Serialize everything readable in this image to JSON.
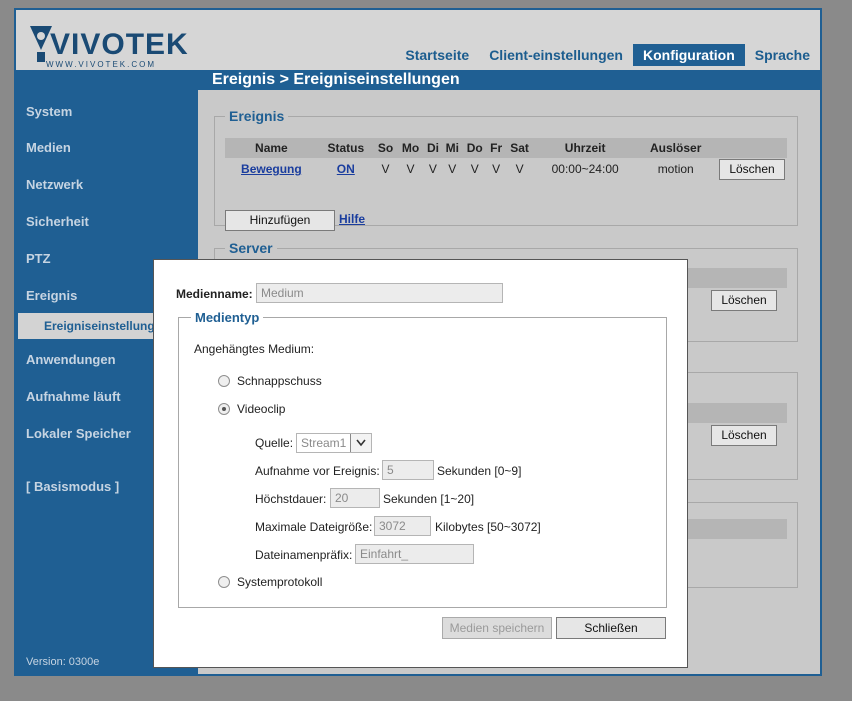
{
  "brand": {
    "name": "VIVOTEK",
    "url": "WWW.VIVOTEK.COM"
  },
  "topnav": [
    "Startseite",
    "Client-einstellungen",
    "Konfiguration",
    "Sprache"
  ],
  "breadcrumb": "Ereignis  > Ereigniseinstellungen",
  "sidebar": {
    "items": [
      "System",
      "Medien",
      "Netzwerk",
      "Sicherheit",
      "PTZ",
      "Ereignis"
    ],
    "sub_item": "Ereigniseinstellungen",
    "items_after": [
      "Anwendungen",
      "Aufnahme läuft",
      "Lokaler Speicher"
    ],
    "basic_mode": "[ Basismodus ]",
    "version": "Version: 0300e"
  },
  "event_section": {
    "legend": "Ereignis",
    "columns": [
      "Name",
      "Status",
      "So",
      "Mo",
      "Di",
      "Mi",
      "Do",
      "Fr",
      "Sat",
      "Uhrzeit",
      "Auslöser"
    ],
    "row": {
      "name": "Bewegung",
      "status": "ON",
      "days": [
        "V",
        "V",
        "V",
        "V",
        "V",
        "V",
        "V"
      ],
      "time": "00:00~24:00",
      "trigger": "motion",
      "delete": "Löschen"
    },
    "add_button": "Hinzufügen",
    "help_link": "Hilfe"
  },
  "server_section": {
    "legend": "Server",
    "delete": "Löschen"
  },
  "media_section": {
    "delete": "Löschen"
  },
  "modal": {
    "medianame_label": "Medienname:",
    "medianame_placeholder": "Medium",
    "mediatyp_legend": "Medientyp",
    "attached_label": "Angehängtes Medium:",
    "options": {
      "snapshot": "Schnappschuss",
      "videoclip": "Videoclip",
      "systemlog": "Systemprotokoll"
    },
    "selected_option": "Videoclip",
    "source_label": "Quelle:",
    "source_value": "Stream1",
    "pre_event_label": "Aufnahme vor Ereignis:",
    "pre_event_value": "5",
    "pre_event_unit": "Sekunden [0~9]",
    "max_duration_label": "Höchstdauer:",
    "max_duration_value": "20",
    "max_duration_unit": "Sekunden [1~20]",
    "max_size_label": "Maximale Dateigröße:",
    "max_size_value": "3072",
    "max_size_unit": "Kilobytes [50~3072]",
    "prefix_label": "Dateinamenpräfix:",
    "prefix_value": "Einfahrt_",
    "save_button": "Medien speichern",
    "close_button": "Schließen"
  },
  "colors": {
    "primary": "#1f5f93",
    "link": "#1a3d9e",
    "overlay": "#8a8a8a"
  }
}
